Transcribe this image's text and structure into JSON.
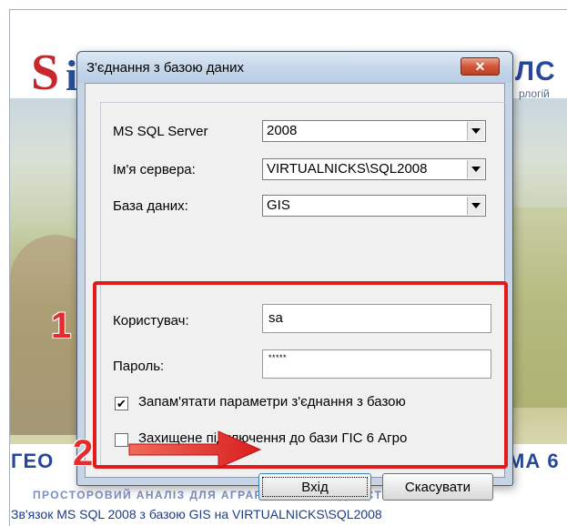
{
  "splash": {
    "logo_letter": "S",
    "logo_letter2": "i",
    "brand_partial": "ЛС",
    "brand_sub_partial": "рлогій",
    "banner_left": "ГЕО",
    "banner_right": "МА 6",
    "banner_sub": "ПРОСТОРОВИЙ АНАЛІЗ ДЛЯ АГРАРНИХ ГОСПОДАРСТВ УКРАЇНИ",
    "status": "Зв'язок MS SQL 2008 з базою GIS на VIRTUALNICKS\\SQL2008"
  },
  "dialog": {
    "title": "З'єднання з базою даних",
    "close_glyph": "✕",
    "fields": {
      "server_version_label": "MS SQL Server",
      "server_version_value": "2008",
      "server_name_label": "Ім'я сервера:",
      "server_name_value": "VIRTUALNICKS\\SQL2008",
      "database_label": "База даних:",
      "database_value": "GIS",
      "user_label": "Користувач:",
      "user_value": "sa",
      "password_label": "Пароль:",
      "password_value": "*****"
    },
    "checkboxes": {
      "remember_label": "Запам'ятати параметри з'єднання з базою",
      "remember_checked": true,
      "remember_mark": "✔",
      "secure_label": "Захищене підключення до бази ГІС 6 Агро",
      "secure_checked": false
    },
    "buttons": {
      "login": "Вхід",
      "cancel": "Скасувати"
    }
  },
  "annotations": {
    "step1": "1",
    "step2": "2",
    "highlight_color": "#e11b1b"
  }
}
